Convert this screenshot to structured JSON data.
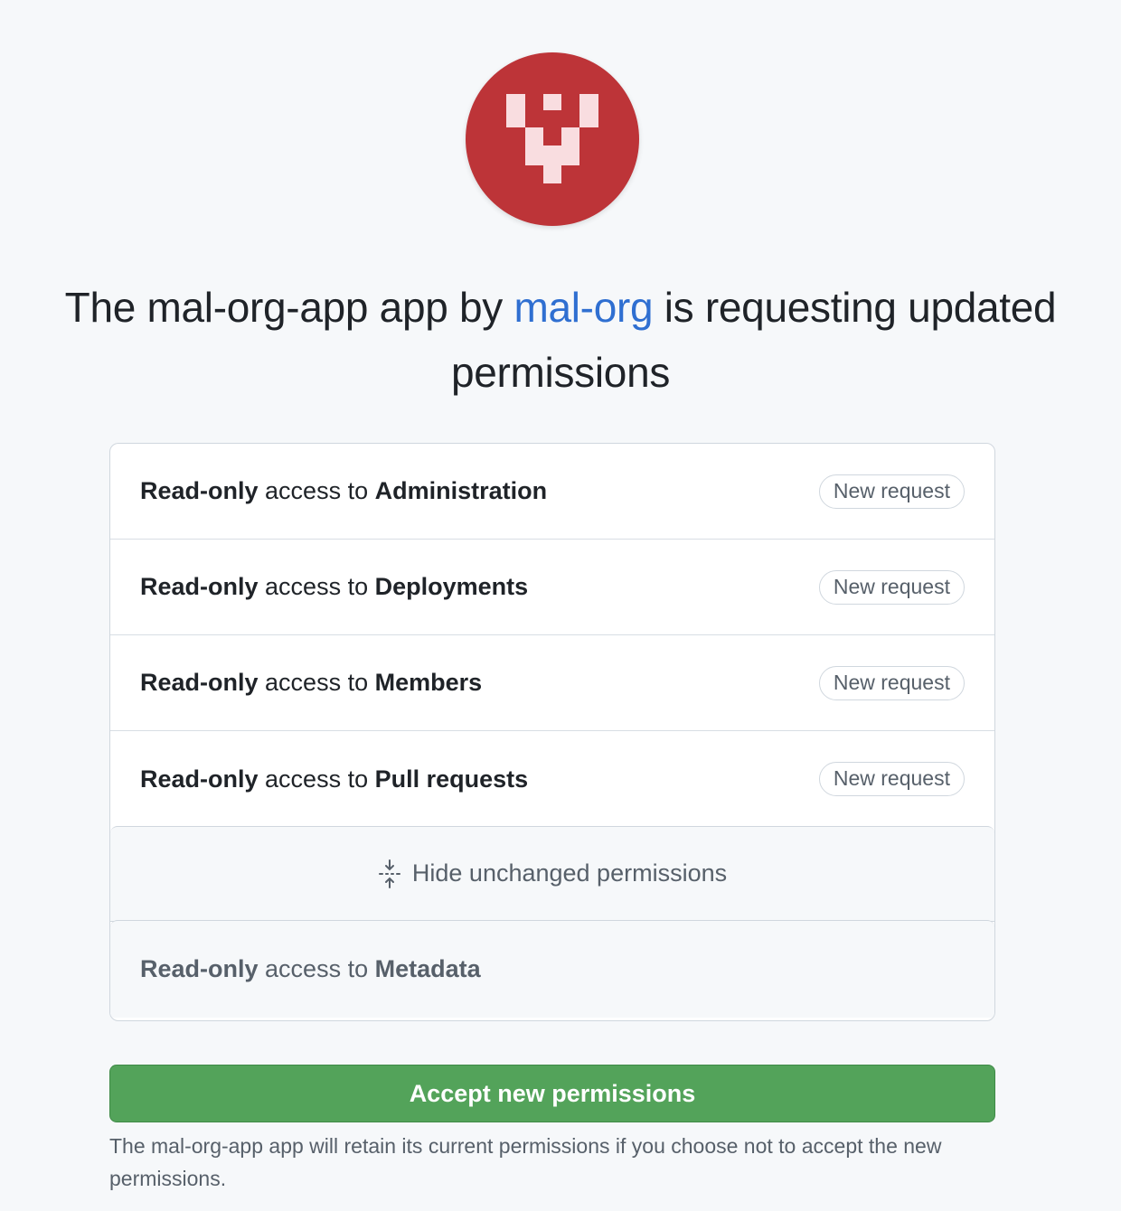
{
  "app": {
    "avatar_color": "#bd3438",
    "avatar_icon": "identicon-logo"
  },
  "title": {
    "prefix": "The mal-org-app app by ",
    "org_link": "mal-org",
    "suffix": " is requesting updated permissions"
  },
  "permissions": [
    {
      "level": "Read-only",
      "connector": " access to ",
      "resource": "Administration",
      "badge": "New request"
    },
    {
      "level": "Read-only",
      "connector": " access to ",
      "resource": "Deployments",
      "badge": "New request"
    },
    {
      "level": "Read-only",
      "connector": " access to ",
      "resource": "Members",
      "badge": "New request"
    },
    {
      "level": "Read-only",
      "connector": " access to ",
      "resource": "Pull requests",
      "badge": "New request"
    }
  ],
  "toggle": {
    "label": "Hide unchanged permissions",
    "icon": "fold-icon"
  },
  "unchanged": [
    {
      "level": "Read-only",
      "connector": " access to ",
      "resource": "Metadata"
    }
  ],
  "accept_button": {
    "label": "Accept new permissions",
    "color": "#53a35a"
  },
  "note": "The mal-org-app app will retain its current permissions if you choose not to accept the new permissions."
}
